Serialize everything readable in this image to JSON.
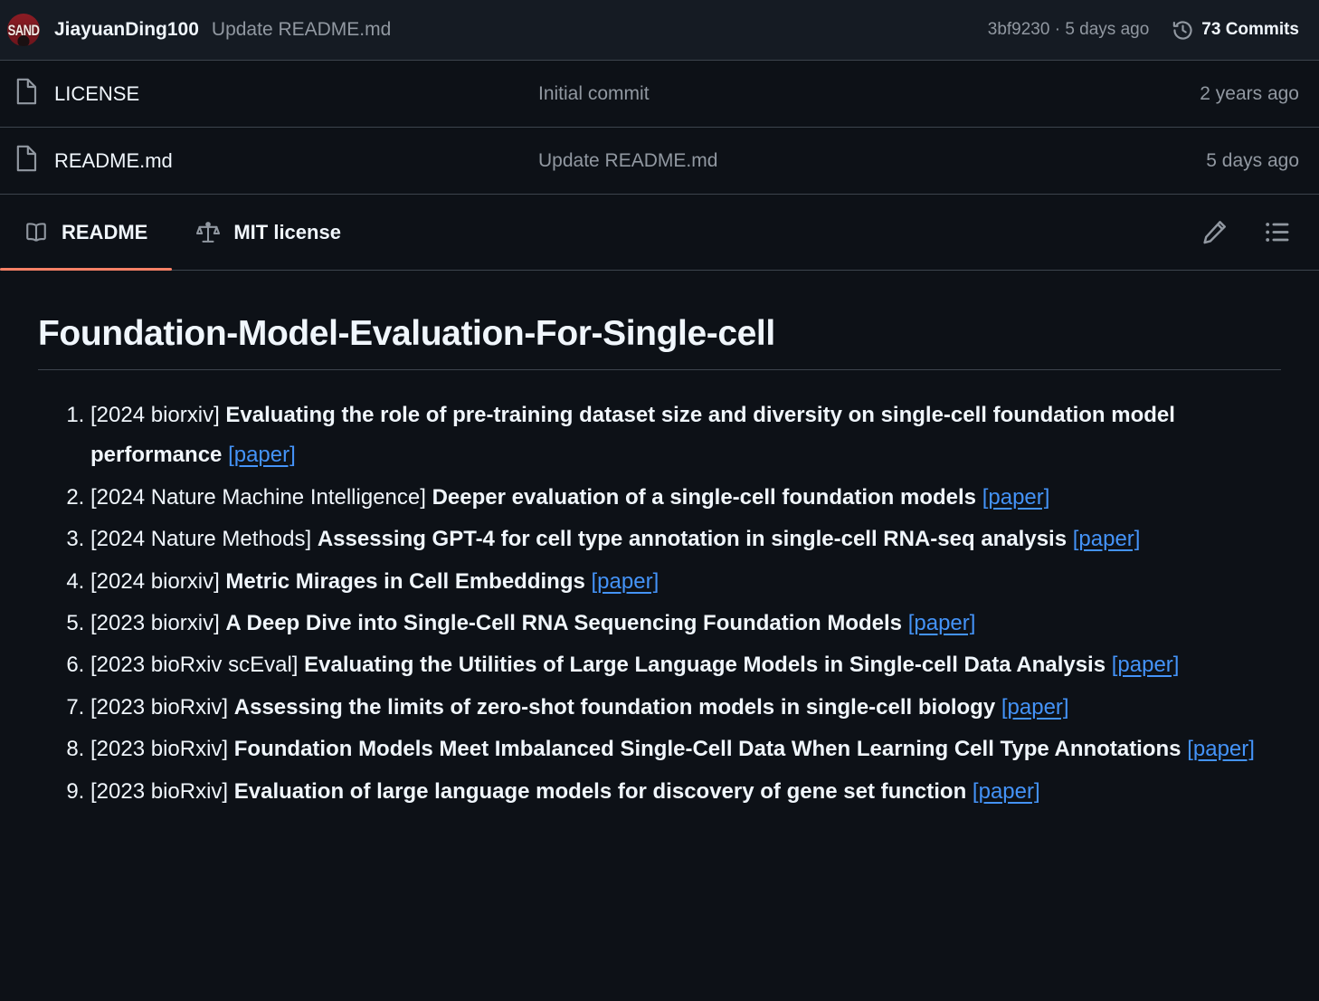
{
  "commit_header": {
    "avatar_text": "SAND",
    "avatar_name": "avatar",
    "author": "JiayuanDing100",
    "commit_message": "Update README.md",
    "commit_sha_time": "3bf9230 · 5 days ago",
    "commits_label": "73 Commits",
    "history_icon": "history-clock-icon",
    "accent_color": "#f78166"
  },
  "files": {
    "rows": [
      {
        "icon": "file-icon",
        "name": "LICENSE",
        "commit_message": "Initial commit",
        "time": "2 years ago"
      },
      {
        "icon": "file-icon",
        "name": "README.md",
        "commit_message": "Update README.md",
        "time": "5 days ago"
      }
    ]
  },
  "tabbar": {
    "tabs": [
      {
        "label": "README",
        "icon": "book-icon",
        "active": true
      },
      {
        "label": "MIT license",
        "icon": "scales-icon",
        "active": false
      }
    ],
    "actions": [
      {
        "name": "edit-pencil-icon"
      },
      {
        "name": "outline-list-icon"
      }
    ]
  },
  "readme": {
    "title": "Foundation-Model-Evaluation-For-Single-cell",
    "link_label": "[paper]",
    "link_color": "#4493f8",
    "items": [
      {
        "venue": "[2024 biorxiv] ",
        "title": "Evaluating the role of pre-training dataset size and diversity on single-cell foundation model performance",
        "link": "[paper]"
      },
      {
        "venue": "[2024 Nature Machine Intelligence] ",
        "title": "Deeper evaluation of a single-cell foundation models",
        "link": "[paper]"
      },
      {
        "venue": "[2024 Nature Methods] ",
        "title": "Assessing GPT-4 for cell type annotation in single-cell RNA-seq analysis",
        "link": "[paper]"
      },
      {
        "venue": "[2024 biorxiv] ",
        "title": "Metric Mirages in Cell Embeddings",
        "link": "[paper]"
      },
      {
        "venue": "[2023 biorxiv] ",
        "title": "A Deep Dive into Single-Cell RNA Sequencing Foundation Models",
        "link": "[paper]"
      },
      {
        "venue": "[2023 bioRxiv scEval] ",
        "title": "Evaluating the Utilities of Large Language Models in Single-cell Data Analysis",
        "link": "[paper]"
      },
      {
        "venue": "[2023 bioRxiv] ",
        "title": "Assessing the limits of zero-shot foundation models in single-cell biology",
        "link": "[paper]"
      },
      {
        "venue": "[2023 bioRxiv] ",
        "title": "Foundation Models Meet Imbalanced Single-Cell Data When Learning Cell Type Annotations",
        "link": "[paper]"
      },
      {
        "venue": "[2023 bioRxiv] ",
        "title": "Evaluation of large language models for discovery of gene set function",
        "link": "[paper]"
      }
    ]
  }
}
